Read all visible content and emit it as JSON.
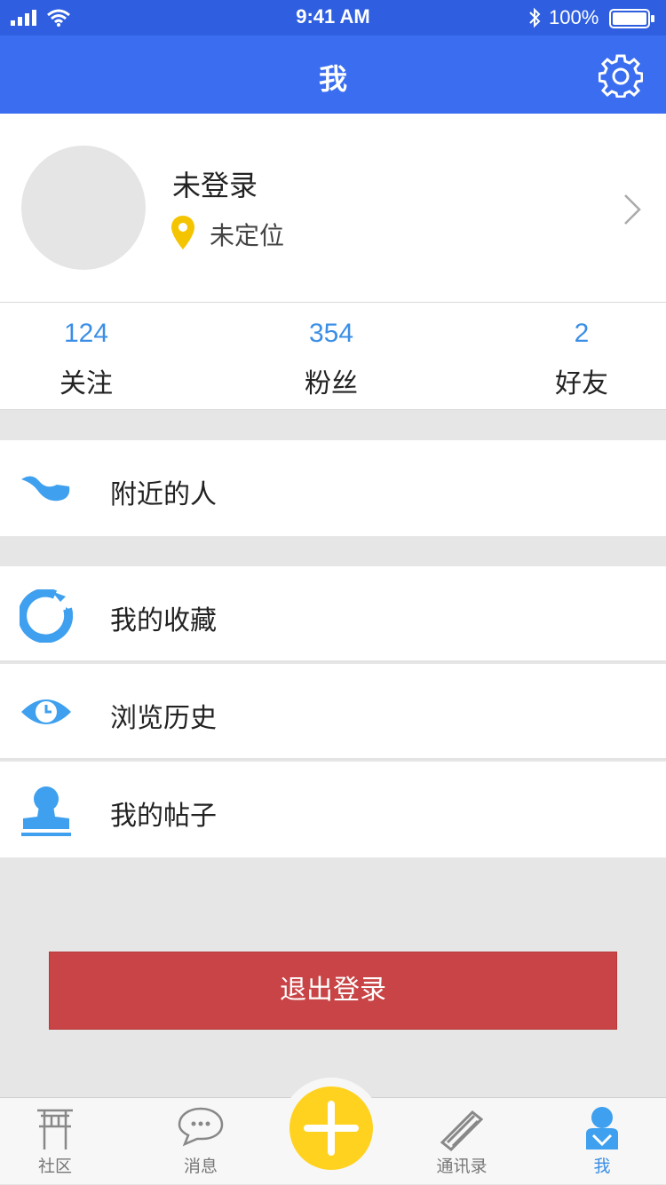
{
  "status_bar": {
    "time": "9:41 AM",
    "battery_text": "100%"
  },
  "nav": {
    "title": "我",
    "settings_icon": "gear-icon"
  },
  "profile": {
    "name": "未登录",
    "location": "未定位",
    "pin_color": "#f5c400"
  },
  "stats": [
    {
      "value": "124",
      "label": "关注"
    },
    {
      "value": "354",
      "label": "粉丝"
    },
    {
      "value": "2",
      "label": "好友"
    }
  ],
  "menu": {
    "nearby": {
      "label": "附近的人",
      "icon": "nearby-icon"
    },
    "favorites": {
      "label": "我的收藏",
      "icon": "favorites-icon"
    },
    "history": {
      "label": "浏览历史",
      "icon": "history-eye-icon"
    },
    "posts": {
      "label": "我的帖子",
      "icon": "stamp-icon"
    }
  },
  "logout_label": "退出登录",
  "tabs": [
    {
      "label": "社区",
      "icon": "pavilion-icon"
    },
    {
      "label": "消息",
      "icon": "chat-bubble-icon"
    },
    {
      "label": "通讯录",
      "icon": "contacts-icon"
    },
    {
      "label": "我",
      "icon": "user-icon",
      "active": true
    }
  ],
  "colors": {
    "nav_blue": "#3a6df0",
    "accent_blue": "#3a8ee6",
    "icon_blue": "#3ea0ef",
    "logout_red": "#c84446",
    "fab_yellow": "#ffd21f"
  }
}
